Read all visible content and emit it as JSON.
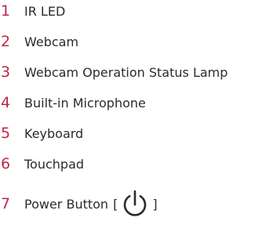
{
  "legend": {
    "number_color": "#c0264a",
    "items": [
      {
        "number": "1",
        "label": "IR LED"
      },
      {
        "number": "2",
        "label": "Webcam"
      },
      {
        "number": "3",
        "label": "Webcam Operation Status Lamp"
      },
      {
        "number": "4",
        "label": "Built-in Microphone"
      },
      {
        "number": "5",
        "label": "Keyboard"
      },
      {
        "number": "6",
        "label": "Touchpad"
      },
      {
        "number": "7",
        "label": "Power Button",
        "bracket_open": "[",
        "icon": "power-icon",
        "bracket_close": "]"
      }
    ]
  }
}
